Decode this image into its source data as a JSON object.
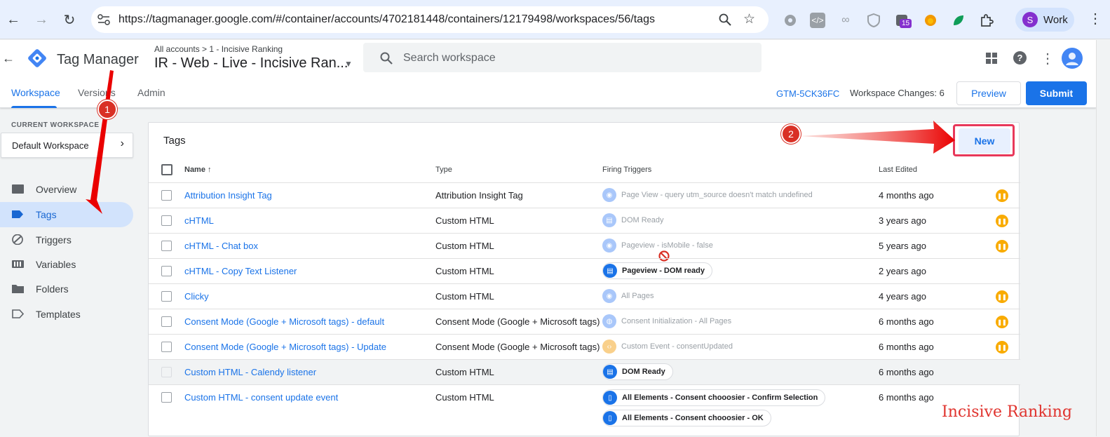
{
  "browser": {
    "url": "https://tagmanager.google.com/#/container/accounts/4702181448/containers/12179498/workspaces/56/tags",
    "profile_initial": "S",
    "profile_name": "Work",
    "extension_badge": "15"
  },
  "header": {
    "app_name": "Tag Manager",
    "breadcrumb": "All accounts > 1 - Incisive Ranking",
    "container_name": "IR - Web - Live - Incisive Ran...",
    "search_placeholder": "Search workspace",
    "tabs": [
      {
        "label": "Workspace",
        "active": true
      },
      {
        "label": "Versions",
        "active": false
      },
      {
        "label": "Admin",
        "active": false
      }
    ],
    "container_id": "GTM-5CK36FC",
    "workspace_changes": "Workspace Changes: 6",
    "preview_label": "Preview",
    "submit_label": "Submit"
  },
  "sidebar": {
    "current_workspace_label": "CURRENT WORKSPACE",
    "workspace_name": "Default Workspace",
    "items": [
      {
        "label": "Overview",
        "icon": "overview-icon",
        "active": false
      },
      {
        "label": "Tags",
        "icon": "tag-icon",
        "active": true
      },
      {
        "label": "Triggers",
        "icon": "trigger-icon",
        "active": false
      },
      {
        "label": "Variables",
        "icon": "variables-icon",
        "active": false
      },
      {
        "label": "Folders",
        "icon": "folder-icon",
        "active": false
      },
      {
        "label": "Templates",
        "icon": "template-icon",
        "active": false
      }
    ]
  },
  "tags_card": {
    "title": "Tags",
    "new_label": "New",
    "columns": {
      "name": "Name",
      "type": "Type",
      "firing_triggers": "Firing Triggers",
      "last_edited": "Last Edited"
    },
    "rows": [
      {
        "name": "Attribution Insight Tag",
        "type": "Attribution Insight Tag",
        "triggers": [
          {
            "label": "Page View - query utm_source doesn't match undefined",
            "icon": "eye-icon",
            "style": "paused"
          }
        ],
        "last_edited": "4 months ago",
        "paused": true
      },
      {
        "name": "cHTML",
        "type": "Custom HTML",
        "triggers": [
          {
            "label": "DOM Ready",
            "icon": "document-icon",
            "style": "paused"
          }
        ],
        "last_edited": "3 years ago",
        "paused": true
      },
      {
        "name": "cHTML - Chat box",
        "type": "Custom HTML",
        "triggers": [
          {
            "label": "Pageview - isMobile - false",
            "icon": "eye-icon",
            "style": "paused"
          }
        ],
        "last_edited": "5 years ago",
        "paused": true
      },
      {
        "name": "cHTML - Copy Text Listener",
        "type": "Custom HTML",
        "triggers": [
          {
            "label": "Pageview - DOM ready",
            "icon": "document-icon",
            "style": "chip"
          }
        ],
        "last_edited": "2 years ago",
        "paused": false
      },
      {
        "name": "Clicky",
        "type": "Custom HTML",
        "triggers": [
          {
            "label": "All Pages",
            "icon": "eye-icon",
            "style": "paused"
          }
        ],
        "last_edited": "4 years ago",
        "paused": true
      },
      {
        "name": "Consent Mode (Google + Microsoft tags) - default",
        "type": "Consent Mode (Google + Microsoft tags)",
        "triggers": [
          {
            "label": "Consent Initialization - All Pages",
            "icon": "globe-icon",
            "style": "paused"
          }
        ],
        "last_edited": "6 months ago",
        "paused": true
      },
      {
        "name": "Consent Mode (Google + Microsoft tags) - Update",
        "type": "Consent Mode (Google + Microsoft tags)",
        "triggers": [
          {
            "label": "Custom Event - consentUpdated",
            "icon": "code-icon",
            "style": "paused"
          }
        ],
        "last_edited": "6 months ago",
        "paused": true
      },
      {
        "name": "Custom HTML - Calendy listener",
        "type": "Custom HTML",
        "triggers": [
          {
            "label": "DOM Ready",
            "icon": "document-icon",
            "style": "chip"
          }
        ],
        "last_edited": "6 months ago",
        "paused": false
      },
      {
        "name": "Custom HTML - consent update event",
        "type": "Custom HTML",
        "triggers": [
          {
            "label": "All Elements - Consent chooosier - Confirm Selection",
            "icon": "click-icon",
            "style": "chip"
          },
          {
            "label": "All Elements - Consent chooosier - OK",
            "icon": "click-icon",
            "style": "chip"
          }
        ],
        "last_edited": "6 months ago",
        "paused": false
      }
    ]
  },
  "annotations": {
    "step1": "1",
    "step2": "2",
    "watermark": "Incisive Ranking"
  },
  "colors": {
    "accent": "#1a73e8",
    "annotation": "#d93025",
    "highlight": "#e8385a",
    "paused": "#f9ab00"
  }
}
